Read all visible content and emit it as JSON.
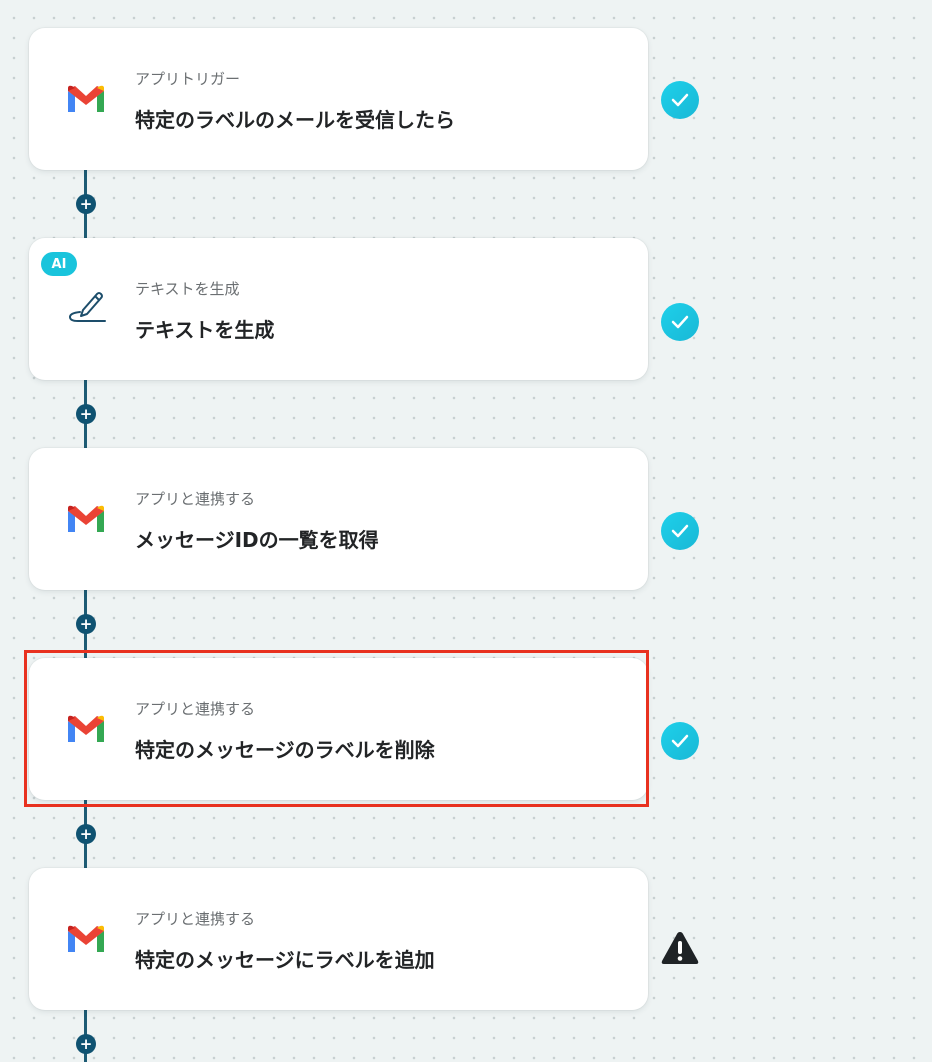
{
  "flow": {
    "steps": [
      {
        "icon": "gmail-icon",
        "subtitle": "アプリトリガー",
        "title": "特定のラベルのメールを受信したら",
        "status": "completed"
      },
      {
        "icon": "pencil-icon",
        "badge": "AI",
        "subtitle": "テキストを生成",
        "title": "テキストを生成",
        "status": "completed"
      },
      {
        "icon": "gmail-icon",
        "subtitle": "アプリと連携する",
        "title": "メッセージIDの一覧を取得",
        "status": "completed"
      },
      {
        "icon": "gmail-icon",
        "subtitle": "アプリと連携する",
        "title": "特定のメッセージのラベルを削除",
        "status": "completed",
        "highlighted": true
      },
      {
        "icon": "gmail-icon",
        "subtitle": "アプリと連携する",
        "title": "特定のメッセージにラベルを追加",
        "status": "warning"
      }
    ],
    "add_step_symbol": "+"
  },
  "colors": {
    "accent": "#19c4dc",
    "connector": "#1d5b74",
    "highlight": "#e8311f"
  }
}
